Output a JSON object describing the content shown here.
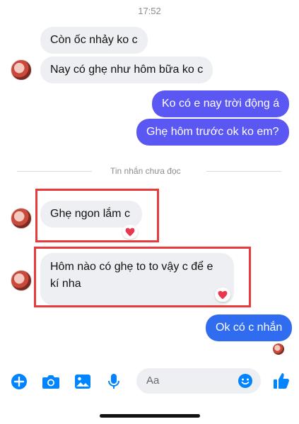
{
  "status_bar": {
    "time": "17:52"
  },
  "messages": {
    "m1": "Còn ốc nhảy ko c",
    "m2": "Nay có ghẹ như hôm bữa ko c",
    "m3": "Ko có e nay trời động á",
    "m4": "Ghẹ hôm trước ok ko em?",
    "m5": "Ghẹ ngon lắm c",
    "m6": "Hôm nào có ghẹ to to vậy c để e kí nha",
    "m7": "Ok có c nhắn"
  },
  "divider": {
    "label": "Tin nhắn chưa đọc"
  },
  "composer": {
    "placeholder": "Aa"
  },
  "colors": {
    "accent": "#0084ff",
    "outgoing_bubble": "#5b57f2",
    "incoming_bubble": "#eeeff3",
    "highlight": "#e83a3a"
  }
}
